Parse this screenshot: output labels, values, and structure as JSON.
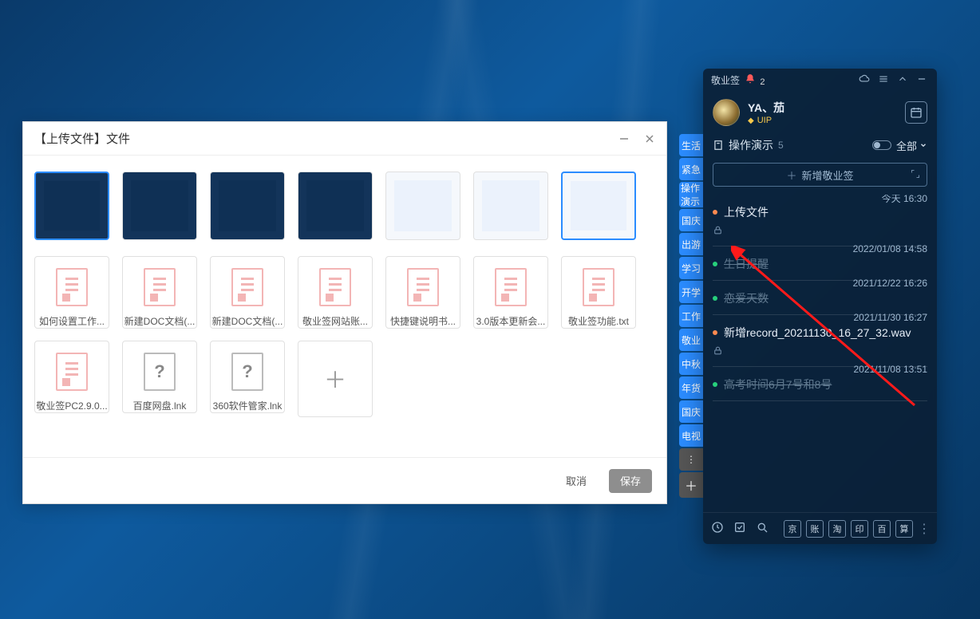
{
  "dialog": {
    "title": "【上传文件】文件",
    "thumbnails_dark_count": 4,
    "thumbnails_light_count": 3,
    "doc_files": [
      "如何设置工作...",
      "新建DOC文档(...",
      "新建DOC文档(...",
      "敬业签网站账...",
      "快捷键说明书...",
      "3.0版本更新会...",
      "敬业签功能.txt"
    ],
    "misc_files": [
      "敬业签PC2.9.0...",
      "百度网盘.lnk",
      "360软件管家.lnk"
    ],
    "cancel_label": "取消",
    "save_label": "保存"
  },
  "sidetags": [
    "生活",
    "紧急",
    "操作演示",
    "国庆",
    "出游",
    "学习",
    "开学",
    "工作",
    "敬业",
    "中秋",
    "年货",
    "国庆",
    "电视"
  ],
  "app": {
    "brand": "敬业签",
    "notif_count": "2",
    "username": "YA、茄",
    "vip_label": "UIP",
    "section_title": "操作演示",
    "section_count": "5",
    "filter_label": "全部",
    "new_note_label": "新增敬业签",
    "notes": [
      {
        "ts": "今天 16:30",
        "dot": "orange",
        "title": "上传文件",
        "lock": true
      },
      {
        "ts": "2022/01/08 14:58",
        "dot": "green",
        "title": "生日提醒",
        "style": "strike"
      },
      {
        "ts": "2021/12/22 16:26",
        "dot": "green",
        "title": "恋爱天数",
        "style": "strike"
      },
      {
        "ts": "2021/11/30 16:27",
        "dot": "orange",
        "title": "新增record_20211130_16_27_32.wav",
        "lock": true
      },
      {
        "ts": "2021/11/08 13:51",
        "dot": "green",
        "title": "高考时间6月7号和8号",
        "style": "strike"
      }
    ],
    "footer_squares": [
      "京",
      "账",
      "淘",
      "印",
      "百",
      "算"
    ]
  }
}
